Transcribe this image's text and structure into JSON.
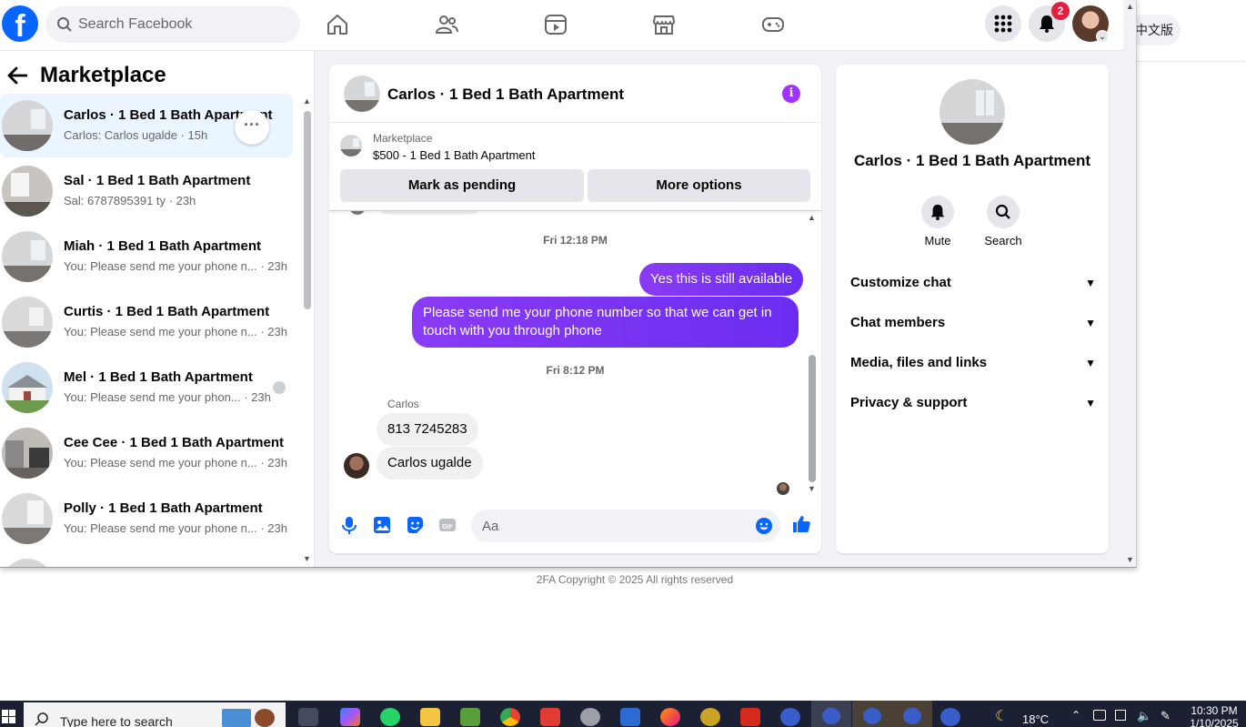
{
  "topbar": {
    "logo_letter": "f",
    "search_placeholder": "Search Facebook",
    "notification_count": "2"
  },
  "background": {
    "lang_label": "中文版",
    "copyright": "2FA Copyright © 2025 All rights reserved"
  },
  "left_panel": {
    "title": "Marketplace",
    "conversations": [
      {
        "title": "Carlos · 1 Bed 1 Bath Apartment",
        "sub": "Carlos: Carlos ugalde · 15h"
      },
      {
        "title": "Sal · 1 Bed 1 Bath Apartment",
        "sub": "Sal: 6787895391 ty · 23h"
      },
      {
        "title": "Miah · 1 Bed 1 Bath Apartment",
        "sub": "You: Please send me your phone n... · 23h"
      },
      {
        "title": "Curtis · 1 Bed 1 Bath Apartment",
        "sub": "You: Please send me your phone n... · 23h"
      },
      {
        "title": "Mel · 1 Bed 1 Bath Apartment",
        "sub": "You: Please send me your phon... · 23h"
      },
      {
        "title": "Cee Cee · 1 Bed 1 Bath Apartment",
        "sub": "You: Please send me your phone n... · 23h"
      },
      {
        "title": "Polly · 1 Bed 1 Bath Apartment",
        "sub": "You: Please send me your phone n... · 23h"
      }
    ],
    "more_label": "···"
  },
  "chat": {
    "title": "Carlos · 1 Bed 1 Bath Apartment",
    "info_label": "i",
    "listing": {
      "source": "Marketplace",
      "title": "$500 - 1 Bed 1 Bath Apartment",
      "pending_label": "Mark as pending",
      "options_label": "More options"
    },
    "time1": "Fri 12:18 PM",
    "out1": "Yes this is still available",
    "out2": "Please send me your phone  number so that we can get in touch with you through phone",
    "time2": "Fri 8:12 PM",
    "sender": "Carlos",
    "in1": "813 7245283",
    "in2": "Carlos ugalde",
    "composer_placeholder": "Aa"
  },
  "info_panel": {
    "title": "Carlos · 1 Bed 1 Bath Apartment",
    "mute_label": "Mute",
    "search_label": "Search",
    "rows": [
      "Customize chat",
      "Chat members",
      "Media, files and links",
      "Privacy & support"
    ]
  },
  "taskbar": {
    "search_placeholder": "Type here to search",
    "weather": "18°C",
    "time": "10:30 PM",
    "date": "1/10/2025"
  },
  "colors": {
    "fb_blue": "#0866ff",
    "messenger_purple": "#8a3bf5",
    "badge_red": "#e41e3f"
  }
}
